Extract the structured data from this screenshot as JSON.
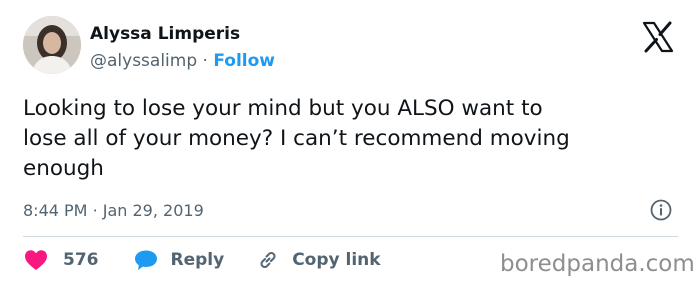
{
  "author": {
    "name": "Alyssa Limperis",
    "handle": "@alyssalimp",
    "separator": "·",
    "follow_label": "Follow"
  },
  "tweet": {
    "text": "Looking to lose your mind but you ALSO want to\nlose all of your money? I can’t recommend moving\nenough",
    "time": "8:44 PM",
    "date_separator": "·",
    "date": "Jan 29, 2019"
  },
  "actions": {
    "likes_count": "576",
    "reply_label": "Reply",
    "copy_link_label": "Copy link"
  },
  "watermark": "boredpanda.com",
  "icons": {
    "logo": "x-logo-icon",
    "info": "info-icon",
    "like": "heart-icon",
    "reply": "speech-bubble-icon",
    "copy": "link-icon"
  },
  "colors": {
    "text": "#0f1419",
    "secondary": "#536471",
    "follow": "#1d9bf0",
    "heart": "#f91880",
    "reply_bubble": "#1d9bf0",
    "divider": "#cfd9de",
    "watermark": "#8e8e8e"
  }
}
